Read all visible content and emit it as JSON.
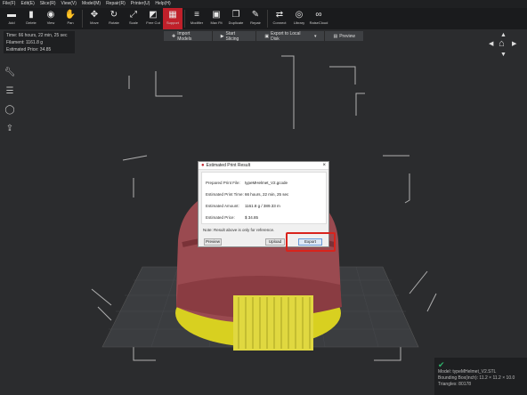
{
  "menubar": [
    "File(F)",
    "Edit(E)",
    "Slice(R)",
    "View(V)",
    "Model(M)",
    "Repair(R)",
    "Printer(U)",
    "Help(H)"
  ],
  "toolbar": [
    {
      "label": "Add",
      "icon": "folder-icon",
      "glyph": "▬",
      "active": false
    },
    {
      "label": "Delete",
      "icon": "trash-icon",
      "glyph": "▮",
      "active": false
    },
    {
      "label": "View",
      "icon": "eye-icon",
      "glyph": "◉",
      "active": false
    },
    {
      "label": "Pan",
      "icon": "hand-icon",
      "glyph": "✋",
      "active": false
    },
    {
      "label": "Move",
      "icon": "move-icon",
      "glyph": "✥",
      "active": false
    },
    {
      "label": "Rotate",
      "icon": "rotate-icon",
      "glyph": "↻",
      "active": false
    },
    {
      "label": "Scale",
      "icon": "scale-icon",
      "glyph": "⤢",
      "active": false
    },
    {
      "label": "Free Cut",
      "icon": "cut-icon",
      "glyph": "◩",
      "active": false
    },
    {
      "label": "Support",
      "icon": "support-icon",
      "glyph": "▦",
      "active": true
    },
    {
      "label": "Modifier",
      "icon": "sliders-icon",
      "glyph": "≡",
      "active": false
    },
    {
      "label": "Max Fit",
      "icon": "max-fit-icon",
      "glyph": "▣",
      "active": false
    },
    {
      "label": "Duplicate",
      "icon": "duplicate-icon",
      "glyph": "❐",
      "active": false
    },
    {
      "label": "Repair",
      "icon": "wrench-icon",
      "glyph": "✎",
      "active": false
    },
    {
      "label": "Connect",
      "icon": "connect-icon",
      "glyph": "⇄",
      "active": false
    },
    {
      "label": "Library",
      "icon": "library-icon",
      "glyph": "◎",
      "active": false
    },
    {
      "label": "RaiseCloud",
      "icon": "cloud-icon",
      "glyph": "∞",
      "active": false
    }
  ],
  "stats": {
    "time": "Time: 66 hours, 22 min, 25 sec",
    "filament": "Filament: 1161.8 g",
    "price": "Estimated Price: 34.85"
  },
  "slicebar": {
    "import": "Import Models",
    "start": "Start Slicing",
    "export": "Export to Local Disk",
    "preview": "Preview"
  },
  "dialog": {
    "title": "Estimated Print Result",
    "close": "×",
    "prepared_label": "Prepared Print File:",
    "prepared_value": "typeMHelmet_V2.gcode",
    "time_label": "Estimated Print Time:",
    "time_value": "66 hours, 22 min, 25 sec",
    "amount_label": "Estimated Amount:",
    "amount_value": "1161.8 g / 389.33 m",
    "price_label": "Estimated Price:",
    "price_value": "$ 34.85",
    "note": "Note: Result above is only for reference.",
    "preview_btn": "Preview",
    "upload_btn": "Upload",
    "export_btn": "Export"
  },
  "model_info": {
    "model": "Model: typeMHelmet_V2.STL",
    "bbox": "Bounding Box(inch): 11.2 × 11.2 × 10.0",
    "triangles": "Triangles: 80178"
  },
  "colors": {
    "accent": "#c0202a",
    "model": "#9a4a50",
    "support": "#d8d020",
    "highlight": "#d9231c"
  }
}
